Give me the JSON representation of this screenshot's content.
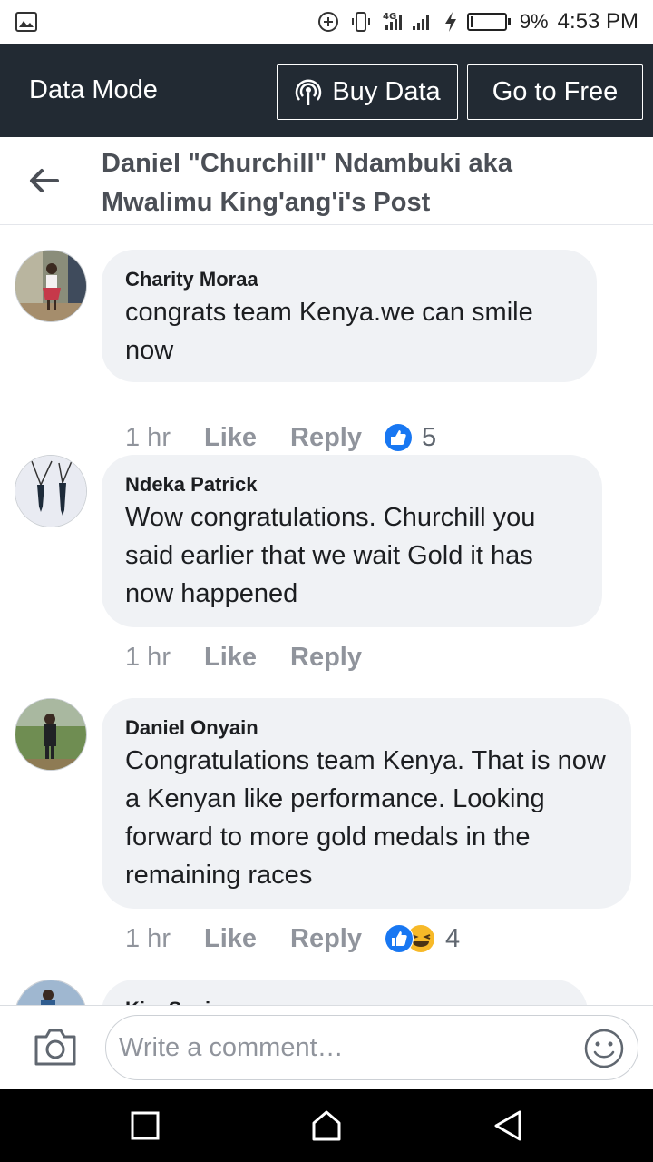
{
  "status_bar": {
    "network": "4G",
    "battery": "9%",
    "battery_level": 0.09,
    "time": "4:53 PM"
  },
  "data_bar": {
    "title": "Data Mode",
    "buy_label": "Buy Data",
    "free_label": "Go to Free"
  },
  "header": {
    "title": "Daniel \"Churchill\" Ndambuki aka Mwalimu King'ang'i's Post"
  },
  "comments": [
    {
      "author": "Charity Moraa",
      "text": "congrats team Kenya.we can smile now",
      "time": "1 hr",
      "like_label": "Like",
      "reply_label": "Reply",
      "reactions": [
        "like"
      ],
      "reaction_count": "5"
    },
    {
      "author": "Ndeka Patrick",
      "text": "Wow congratulations. Churchill you said earlier that we wait Gold it has now happened",
      "time": "1 hr",
      "like_label": "Like",
      "reply_label": "Reply",
      "reactions": [],
      "reaction_count": ""
    },
    {
      "author": "Daniel Onyain",
      "text": "Congratulations team Kenya. That is now a Kenyan like performance. Looking forward to more gold medals in the remaining races",
      "time": "1 hr",
      "like_label": "Like",
      "reply_label": "Reply",
      "reactions": [
        "like",
        "haha"
      ],
      "reaction_count": "4"
    },
    {
      "author": "Kim Senior"
    }
  ],
  "composer": {
    "placeholder": "Write a comment…"
  },
  "colors": {
    "data_bar_bg": "#222a33",
    "bubble_bg": "#f0f2f5",
    "like_blue": "#1877f2",
    "meta_gray": "#90949c"
  }
}
